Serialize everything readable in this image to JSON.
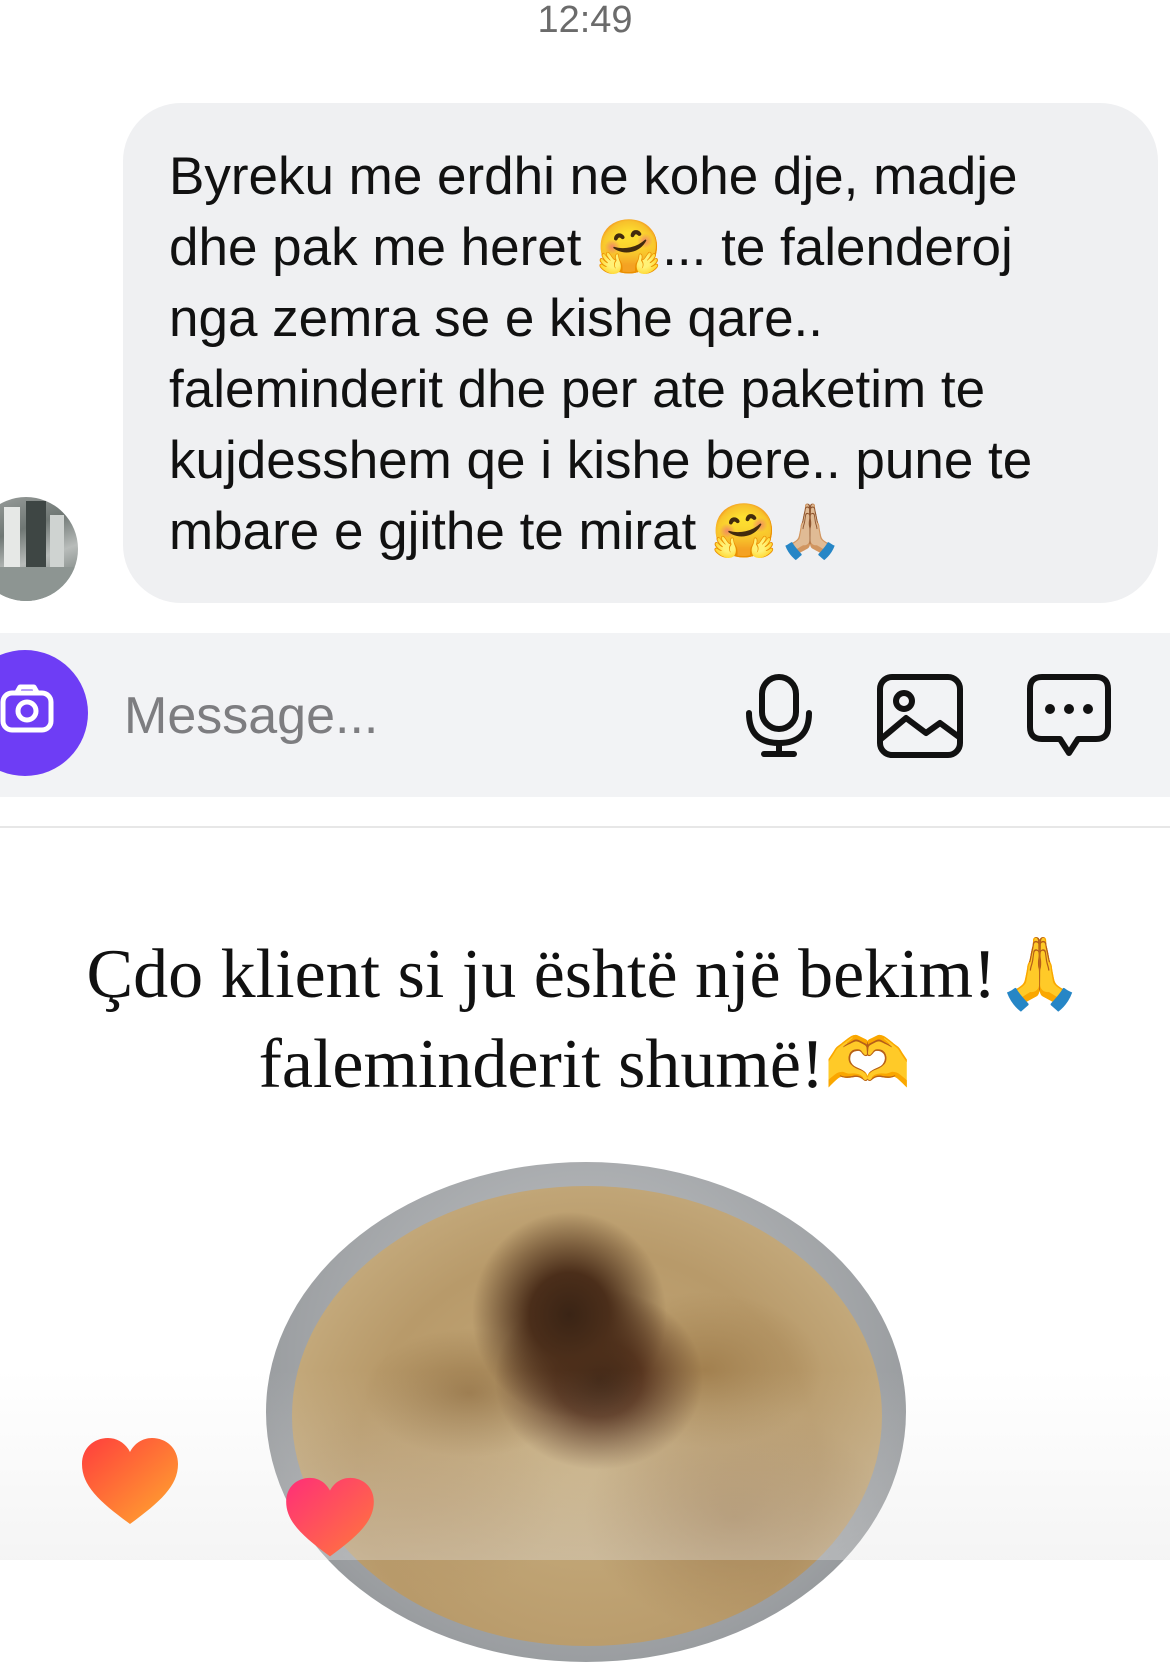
{
  "status": {
    "time": "12:49"
  },
  "message": {
    "text": "Byreku me erdhi ne kohe dje, madje\ndhe pak me heret 🤗... te falenderoj\nnga zemra se e kishe qare..\nfaleminderit dhe per ate paketim te\nkujdesshem qe i kishe bere.. pune te\nmbare e gjithe te mirat 🤗🙏🏼"
  },
  "composer": {
    "placeholder": "Message...",
    "icons": [
      "camera-icon",
      "microphone-icon",
      "image-icon",
      "sticker-message-icon"
    ],
    "accent": "#6e3df5"
  },
  "caption": {
    "line1": "Çdo klient si ju është një bekim!🙏",
    "line2": "faleminderit shumë!🫶"
  },
  "overlay": {
    "icons": [
      "heart-icon",
      "heart-icon"
    ],
    "heart_colors": [
      "#ff6a2b",
      "#ff2e78"
    ]
  }
}
